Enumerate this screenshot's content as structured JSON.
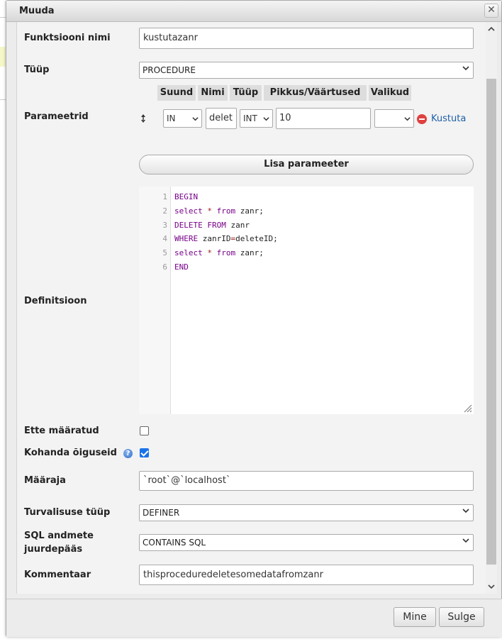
{
  "dialog": {
    "title": "Muuda",
    "close_symbol": "✕"
  },
  "form": {
    "routine_name": {
      "label": "Funktsiooni nimi",
      "value": "kustutazanr"
    },
    "type": {
      "label": "Tüüp",
      "value": "PROCEDURE"
    },
    "parameters": {
      "label": "Parameetrid",
      "headers": [
        "Suund",
        "Nimi",
        "Tüüp",
        "Pikkus/Väärtused",
        "Valikud"
      ],
      "rows": [
        {
          "direction": "IN",
          "name": "delet",
          "type": "INT",
          "length": "10",
          "options": "",
          "delete_label": "Kustuta"
        }
      ],
      "add_button": "Lisa parameeter"
    },
    "definition": {
      "label": "Definitsioon",
      "line_numbers": [
        "1",
        "2",
        "3",
        "4",
        "5",
        "6"
      ]
    },
    "deterministic": {
      "label": "Ette määratud",
      "checked": false
    },
    "adjust_privileges": {
      "label": "Kohanda õiguseid",
      "checked": true
    },
    "definer": {
      "label": "Määraja",
      "value": "`root`@`localhost`"
    },
    "security_type": {
      "label": "Turvalisuse tüüp",
      "value": "DEFINER"
    },
    "sql_access": {
      "label_line1": "SQL andmete",
      "label_line2": "juurdepääs",
      "value": "CONTAINS SQL"
    },
    "comment": {
      "label": "Kommentaar",
      "value": "thisproceduredeletesomedatafromzanr"
    }
  },
  "footer": {
    "go_button": "Mine",
    "close_button": "Sulge"
  },
  "colors": {
    "keyword": "#770088",
    "checkbox_checked": "#1a73e8",
    "delete_icon": "#e04040",
    "link": "#1f5fa8"
  }
}
